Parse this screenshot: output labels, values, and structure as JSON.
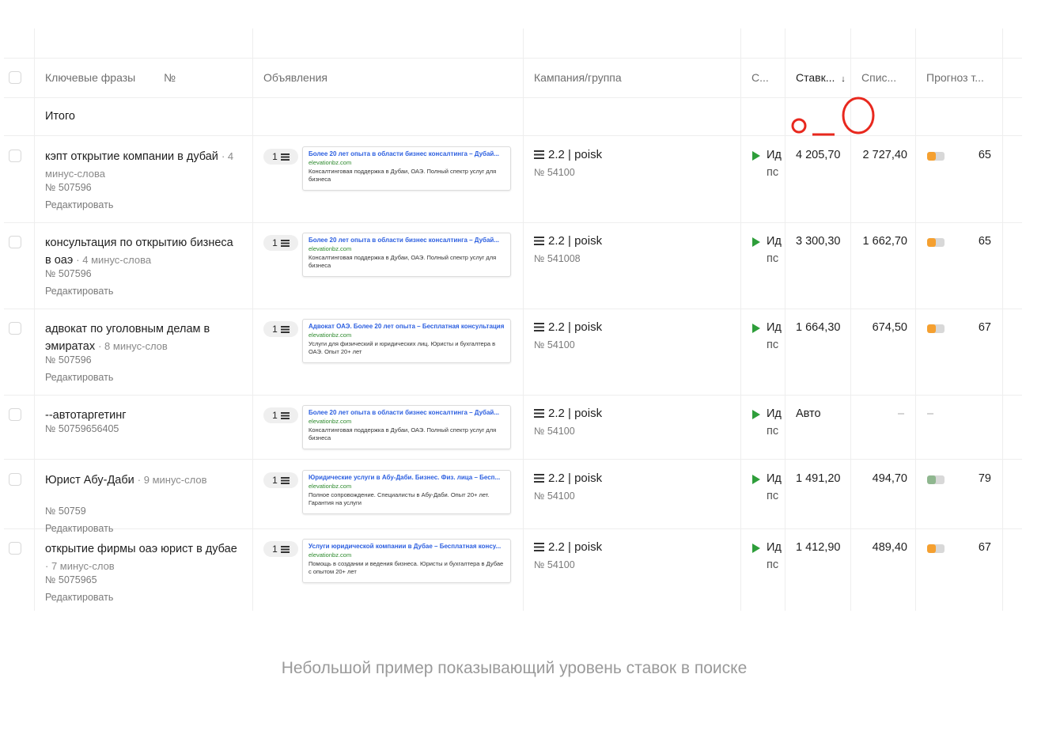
{
  "header": {
    "keywords": "Ключевые фразы",
    "number": "№",
    "ads": "Объявления",
    "campaign": "Кампания/группа",
    "status": "С...",
    "bid": "Ставк...",
    "sort_arrow": "↓",
    "charge": "Спис...",
    "forecast": "Прогноз т..."
  },
  "total_label": "Итого",
  "edit_label": "Редактировать",
  "rows": [
    {
      "keyword": "кэпт открытие компании в дубай",
      "minus": "· 4 минус-слова",
      "id": "№ 507596",
      "ad_count": "1",
      "ad_title": "Более 20 лет опыта в области бизнес консалтинга – Дубай...",
      "ad_domain": "elevationbz.com",
      "ad_text": "Консалтинговая поддержка в Дубаи, ОАЭ. Полный спектр услуг для бизнеса",
      "campaign": "2.2 | poisk",
      "campaign_num": "№ 54100",
      "status1": "Ид",
      "status2": "пс",
      "bid": "4 205,70",
      "charge": "2 727,40",
      "forecast": "65",
      "forecast_level": 0.5,
      "bar_color": "#f5a030"
    },
    {
      "keyword": "консультация по открытию бизнеса в оаэ",
      "minus": "· 4 минус-слова",
      "id": "№ 507596",
      "ad_count": "1",
      "ad_title": "Более 20 лет опыта в области бизнес консалтинга – Дубай...",
      "ad_domain": "elevationbz.com",
      "ad_text": "Консалтинговая поддержка в Дубаи, ОАЭ. Полный спектр услуг для бизнеса",
      "campaign": "2.2 | poisk",
      "campaign_num": "№ 541008",
      "status1": "Ид",
      "status2": "пс",
      "bid": "3 300,30",
      "charge": "1 662,70",
      "forecast": "65",
      "forecast_level": 0.5,
      "bar_color": "#f5a030"
    },
    {
      "keyword": "адвокат по уголовным делам в эмиратах",
      "minus": "· 8 минус-слов",
      "id": "№ 507596",
      "ad_count": "1",
      "ad_title": "Адвокат ОАЭ. Более 20 лет опыта – Бесплатная консультация",
      "ad_domain": "elevationbz.com",
      "ad_text": "Услуги для физический и юридических лиц. Юристы и бухгалтера в ОАЭ. Опыт 20+ лет",
      "campaign": "2.2 | poisk",
      "campaign_num": "№ 54100",
      "status1": "Ид",
      "status2": "пс",
      "bid": "1 664,30",
      "charge": "674,50",
      "forecast": "67",
      "forecast_level": 0.5,
      "bar_color": "#f5a030"
    },
    {
      "keyword": "--автотаргетинг",
      "minus": "",
      "id": "№ 50759656405",
      "ad_count": "1",
      "ad_title": "Более 20 лет опыта в области бизнес консалтинга – Дубай...",
      "ad_domain": "elevationbz.com",
      "ad_text": "Консалтинговая поддержка в Дубаи, ОАЭ. Полный спектр услуг для бизнеса",
      "campaign": "2.2 | poisk",
      "campaign_num": "№ 54100",
      "status1": "Ид",
      "status2": "пс",
      "bid": "Авто",
      "charge": "–",
      "forecast": "–",
      "forecast_level": 0,
      "bar_color": ""
    },
    {
      "keyword": "Юрист Абу-Даби",
      "minus": "· 9 минус-слов",
      "id": "№ 50759",
      "ad_count": "1",
      "ad_title": "Юридические услуги в Абу-Даби. Бизнес. Физ. лица – Бесп...",
      "ad_domain": "elevationbz.com",
      "ad_text": "Полное сопровождение. Специалисты в Абу-Даби. Опыт 20+ лет. Гарантия на услуги",
      "campaign": "2.2 | poisk",
      "campaign_num": "№ 54100",
      "status1": "Ид",
      "status2": "пс",
      "bid": "1 491,20",
      "charge": "494,70",
      "forecast": "79",
      "forecast_level": 0.5,
      "bar_color": "#8fb78f"
    },
    {
      "keyword": "открытие фирмы оаэ юрист в дубае",
      "minus": "· 7 минус-слов",
      "id": "№ 5075965",
      "ad_count": "1",
      "ad_title": "Услуги юридической компании в Дубае – Бесплатная консу...",
      "ad_domain": "elevationbz.com",
      "ad_text": "Помощь в создании и ведения бизнеса. Юристы и бухгалтера в Дубае с опытом 20+ лет",
      "campaign": "2.2 | poisk",
      "campaign_num": "№ 54100",
      "status1": "Ид",
      "status2": "пс",
      "bid": "1 412,90",
      "charge": "489,40",
      "forecast": "67",
      "forecast_level": 0.5,
      "bar_color": "#f5a030"
    }
  ],
  "caption": "Небольшой пример показывающий уровень ставок в поиске",
  "annotation_color": "#e8281e"
}
